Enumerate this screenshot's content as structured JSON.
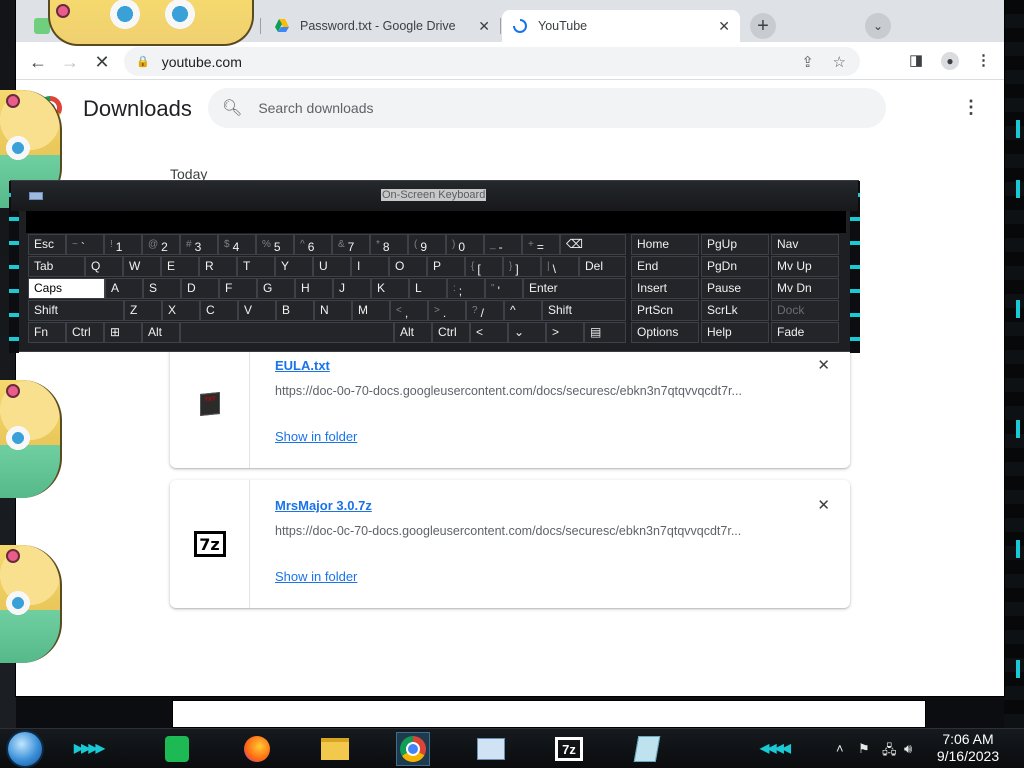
{
  "browser": {
    "tabs": [
      {
        "label": "",
        "icon": "star-butterfly-icon"
      },
      {
        "label": "Password.txt - Google Drive",
        "icon": "google-drive-icon"
      },
      {
        "label": "YouTube",
        "icon": "loading-spinner-icon"
      }
    ],
    "url": "youtube.com"
  },
  "downloads": {
    "title": "Downloads",
    "search_placeholder": "Search downloads",
    "section_date": "Today",
    "items": [
      {
        "filename": "EULA.txt",
        "url": "https://doc-0o-70-docs.googleusercontent.com/docs/securesc/ebkn3n7qtqvvqcdt7r...",
        "action": "Show in folder",
        "icon": "txt-file-icon"
      },
      {
        "filename": "MrsMajor 3.0.7z",
        "url": "https://doc-0c-70-docs.googleusercontent.com/docs/securesc/ebkn3n7qtqvvqcdt7r...",
        "action": "Show in folder",
        "icon": "7z-archive-icon"
      }
    ]
  },
  "keyboard": {
    "title": "On-Screen Keyboard",
    "row1": [
      {
        "sub": "",
        "label": "Esc"
      },
      {
        "sub": "~",
        "label": "`"
      },
      {
        "sub": "!",
        "label": "1"
      },
      {
        "sub": "@",
        "label": "2"
      },
      {
        "sub": "#",
        "label": "3"
      },
      {
        "sub": "$",
        "label": "4"
      },
      {
        "sub": "%",
        "label": "5"
      },
      {
        "sub": "^",
        "label": "6"
      },
      {
        "sub": "&",
        "label": "7"
      },
      {
        "sub": "*",
        "label": "8"
      },
      {
        "sub": "(",
        "label": "9"
      },
      {
        "sub": ")",
        "label": "0"
      },
      {
        "sub": "_",
        "label": "-"
      },
      {
        "sub": "+",
        "label": "="
      },
      {
        "sub": "",
        "label": "⌫"
      }
    ],
    "row2": [
      {
        "sub": "",
        "label": "Tab"
      },
      {
        "sub": "",
        "label": "Q"
      },
      {
        "sub": "",
        "label": "W"
      },
      {
        "sub": "",
        "label": "E"
      },
      {
        "sub": "",
        "label": "R"
      },
      {
        "sub": "",
        "label": "T"
      },
      {
        "sub": "",
        "label": "Y"
      },
      {
        "sub": "",
        "label": "U"
      },
      {
        "sub": "",
        "label": "I"
      },
      {
        "sub": "",
        "label": "O"
      },
      {
        "sub": "",
        "label": "P"
      },
      {
        "sub": "{",
        "label": "["
      },
      {
        "sub": "}",
        "label": "]"
      },
      {
        "sub": "|",
        "label": "\\"
      },
      {
        "sub": "",
        "label": "Del"
      }
    ],
    "row3": [
      {
        "sub": "",
        "label": "Caps"
      },
      {
        "sub": "",
        "label": "A"
      },
      {
        "sub": "",
        "label": "S"
      },
      {
        "sub": "",
        "label": "D"
      },
      {
        "sub": "",
        "label": "F"
      },
      {
        "sub": "",
        "label": "G"
      },
      {
        "sub": "",
        "label": "H"
      },
      {
        "sub": "",
        "label": "J"
      },
      {
        "sub": "",
        "label": "K"
      },
      {
        "sub": "",
        "label": "L"
      },
      {
        "sub": ":",
        "label": ";"
      },
      {
        "sub": "\"",
        "label": "'"
      },
      {
        "sub": "",
        "label": "Enter"
      }
    ],
    "row4": [
      {
        "sub": "",
        "label": "Shift"
      },
      {
        "sub": "",
        "label": "Z"
      },
      {
        "sub": "",
        "label": "X"
      },
      {
        "sub": "",
        "label": "C"
      },
      {
        "sub": "",
        "label": "V"
      },
      {
        "sub": "",
        "label": "B"
      },
      {
        "sub": "",
        "label": "N"
      },
      {
        "sub": "",
        "label": "M"
      },
      {
        "sub": "<",
        "label": ","
      },
      {
        "sub": ">",
        "label": "."
      },
      {
        "sub": "?",
        "label": "/"
      },
      {
        "sub": "",
        "label": "^"
      },
      {
        "sub": "",
        "label": "Shift"
      }
    ],
    "row5": [
      {
        "sub": "",
        "label": "Fn"
      },
      {
        "sub": "",
        "label": "Ctrl"
      },
      {
        "sub": "",
        "label": "⊞"
      },
      {
        "sub": "",
        "label": "Alt"
      },
      {
        "sub": "",
        "label": ""
      },
      {
        "sub": "",
        "label": "Alt"
      },
      {
        "sub": "",
        "label": "Ctrl"
      },
      {
        "sub": "",
        "label": "<"
      },
      {
        "sub": "",
        "label": "⌄"
      },
      {
        "sub": "",
        "label": ">"
      },
      {
        "sub": "",
        "label": "▤"
      }
    ],
    "nav": [
      [
        "Home",
        "PgUp",
        "Nav"
      ],
      [
        "End",
        "PgDn",
        "Mv Up"
      ],
      [
        "Insert",
        "Pause",
        "Mv Dn"
      ],
      [
        "PrtScn",
        "ScrLk",
        "Dock"
      ],
      [
        "Options",
        "Help",
        "Fade"
      ]
    ],
    "active_key": "Caps",
    "disabled_key": "Dock"
  },
  "taskbar": {
    "apps": [
      "notepad-icon",
      "firefox-icon",
      "file-explorer-icon",
      "chrome-icon",
      "task-manager-icon",
      "7zip-icon",
      "document-icon"
    ],
    "clock_time": "7:06 AM",
    "clock_date": "9/16/2023"
  },
  "colors": {
    "accent": "#1a73e8",
    "taskbar_cyan": "#19c9d4"
  }
}
